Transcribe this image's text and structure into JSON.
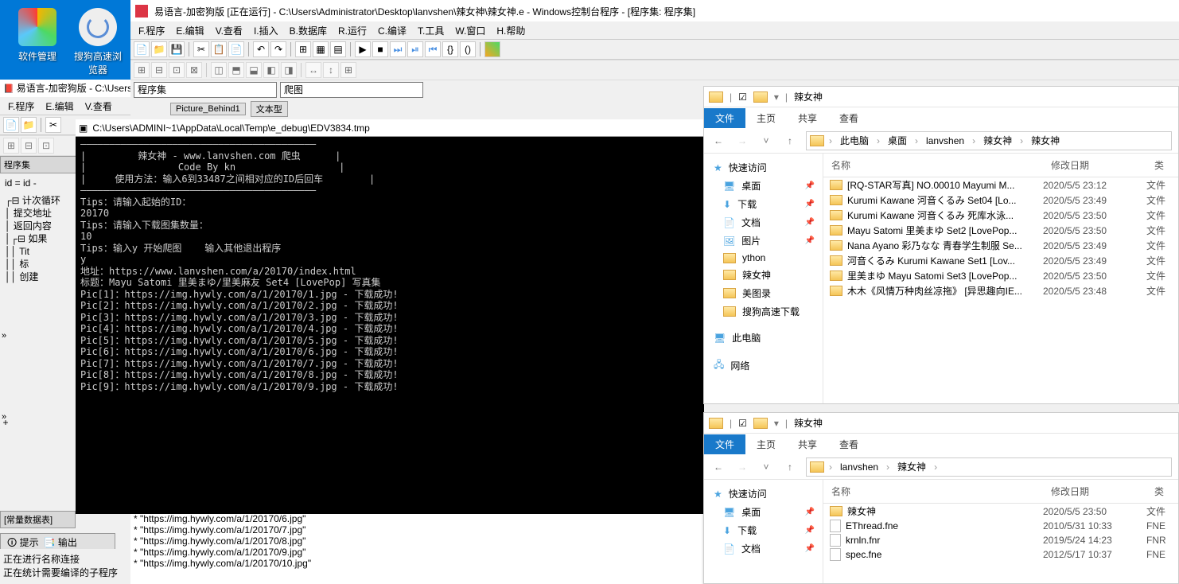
{
  "desktop": {
    "icon1": "软件管理",
    "icon2": "搜狗高速浏览器"
  },
  "ide": {
    "title": "易语言-加密狗版 [正在运行] - C:\\Users\\Administrator\\Desktop\\lanvshen\\辣女神\\辣女神.e - Windows控制台程序 - [程序集: 程序集]",
    "menu": [
      "F.程序",
      "E.编辑",
      "V.查看",
      "I.插入",
      "B.数据库",
      "R.运行",
      "C.编译",
      "T.工具",
      "W.窗口",
      "H.帮助"
    ],
    "combo1": "程序集",
    "combo2": "爬图",
    "label1": "Picture_Behind1",
    "label2": "文本型"
  },
  "ide2": {
    "title": "易语言-加密狗版 - C:\\Users",
    "menu": [
      "F.程序",
      "E.编辑",
      "V.查看"
    ],
    "panel": "程序集",
    "line": "id = id -",
    "tree": [
      "计次循环",
      "提交地址",
      "返回内容",
      "如果",
      "Tit",
      "标",
      "创建"
    ],
    "panel2": "[常量数据表]",
    "tabs": [
      "提示",
      "输出"
    ]
  },
  "console": {
    "title": "C:\\Users\\ADMINI~1\\AppData\\Local\\Temp\\e_debug\\EDV3834.tmp",
    "lines": [
      "—————————————————————————————————————————",
      "|         辣女神 - www.lanvshen.com 爬虫      |",
      "|                Code By kn                  |",
      "|     使用方法：输入6到33487之间相对应的ID后回车        |",
      "—————————————————————————————————————————",
      "Tips：请输入起始的ID：",
      "20170",
      "Tips：请输入下载图集数量：",
      "10",
      "Tips：输入y 开始爬图    输入其他退出程序",
      "y",
      "地址：https://www.lanvshen.com/a/20170/index.html",
      "标题：Mayu Satomi 里美まゆ/里美麻友 Set4 [LovePop] 写真集",
      "Pic[1]：https://img.hywly.com/a/1/20170/1.jpg - 下载成功!",
      "Pic[2]：https://img.hywly.com/a/1/20170/2.jpg - 下载成功!",
      "Pic[3]：https://img.hywly.com/a/1/20170/3.jpg - 下载成功!",
      "Pic[4]：https://img.hywly.com/a/1/20170/4.jpg - 下载成功!",
      "Pic[5]：https://img.hywly.com/a/1/20170/5.jpg - 下载成功!",
      "Pic[6]：https://img.hywly.com/a/1/20170/6.jpg - 下载成功!",
      "Pic[7]：https://img.hywly.com/a/1/20170/7.jpg - 下载成功!",
      "Pic[8]：https://img.hywly.com/a/1/20170/8.jpg - 下载成功!",
      "Pic[9]：https://img.hywly.com/a/1/20170/9.jpg - 下载成功!"
    ]
  },
  "log": {
    "lines": [
      "* \"https://img.hywly.com/a/1/20170/6.jpg\"",
      "* \"https://img.hywly.com/a/1/20170/7.jpg\"",
      "* \"https://img.hywly.com/a/1/20170/8.jpg\"",
      "* \"https://img.hywly.com/a/1/20170/9.jpg\"",
      "* \"https://img.hywly.com/a/1/20170/10.jpg\""
    ]
  },
  "status": {
    "line1": "正在进行名称连接",
    "line2": "正在统计需要编译的子程序"
  },
  "exp1": {
    "title": "辣女神",
    "tabs": [
      "文件",
      "主页",
      "共享",
      "查看"
    ],
    "bc": [
      "此电脑",
      "桌面",
      "lanvshen",
      "辣女神",
      "辣女神"
    ],
    "cols": [
      "名称",
      "修改日期",
      "类"
    ],
    "sb_quick": "快速访问",
    "sb_items": [
      "桌面",
      "下载",
      "文档",
      "图片",
      "ython",
      "辣女神",
      "美图录",
      "搜狗高速下载"
    ],
    "sb_pc": "此电脑",
    "sb_net": "网络",
    "rows": [
      {
        "n": "[RQ-STAR写真] NO.00010 Mayumi M...",
        "d": "2020/5/5 23:12",
        "t": "文件"
      },
      {
        "n": "Kurumi Kawane 河音くるみ Set04 [Lo...",
        "d": "2020/5/5 23:49",
        "t": "文件"
      },
      {
        "n": "Kurumi Kawane 河音くるみ 死库水泳...",
        "d": "2020/5/5 23:50",
        "t": "文件"
      },
      {
        "n": "Mayu Satomi 里美まゆ Set2 [LovePop...",
        "d": "2020/5/5 23:50",
        "t": "文件"
      },
      {
        "n": "Nana Ayano 彩乃なな 青春学生制服 Se...",
        "d": "2020/5/5 23:49",
        "t": "文件"
      },
      {
        "n": "河音くるみ Kurumi Kawane Set1 [Lov...",
        "d": "2020/5/5 23:49",
        "t": "文件"
      },
      {
        "n": "里美まゆ Mayu Satomi Set3 [LovePop...",
        "d": "2020/5/5 23:50",
        "t": "文件"
      },
      {
        "n": "木木《风情万种肉丝凉拖》 [异思趣向IE...",
        "d": "2020/5/5 23:48",
        "t": "文件"
      }
    ]
  },
  "exp2": {
    "title": "辣女神",
    "tabs": [
      "文件",
      "主页",
      "共享",
      "查看"
    ],
    "bc": [
      "lanvshen",
      "辣女神"
    ],
    "cols": [
      "名称",
      "修改日期",
      "类"
    ],
    "sb_quick": "快速访问",
    "sb_items": [
      "桌面",
      "下载",
      "文档"
    ],
    "rows": [
      {
        "n": "辣女神",
        "d": "2020/5/5 23:50",
        "t": "文件",
        "folder": true
      },
      {
        "n": "EThread.fne",
        "d": "2010/5/31 10:33",
        "t": "FNE"
      },
      {
        "n": "krnln.fnr",
        "d": "2019/5/24 14:23",
        "t": "FNR"
      },
      {
        "n": "spec.fne",
        "d": "2012/5/17 10:37",
        "t": "FNE"
      }
    ]
  }
}
